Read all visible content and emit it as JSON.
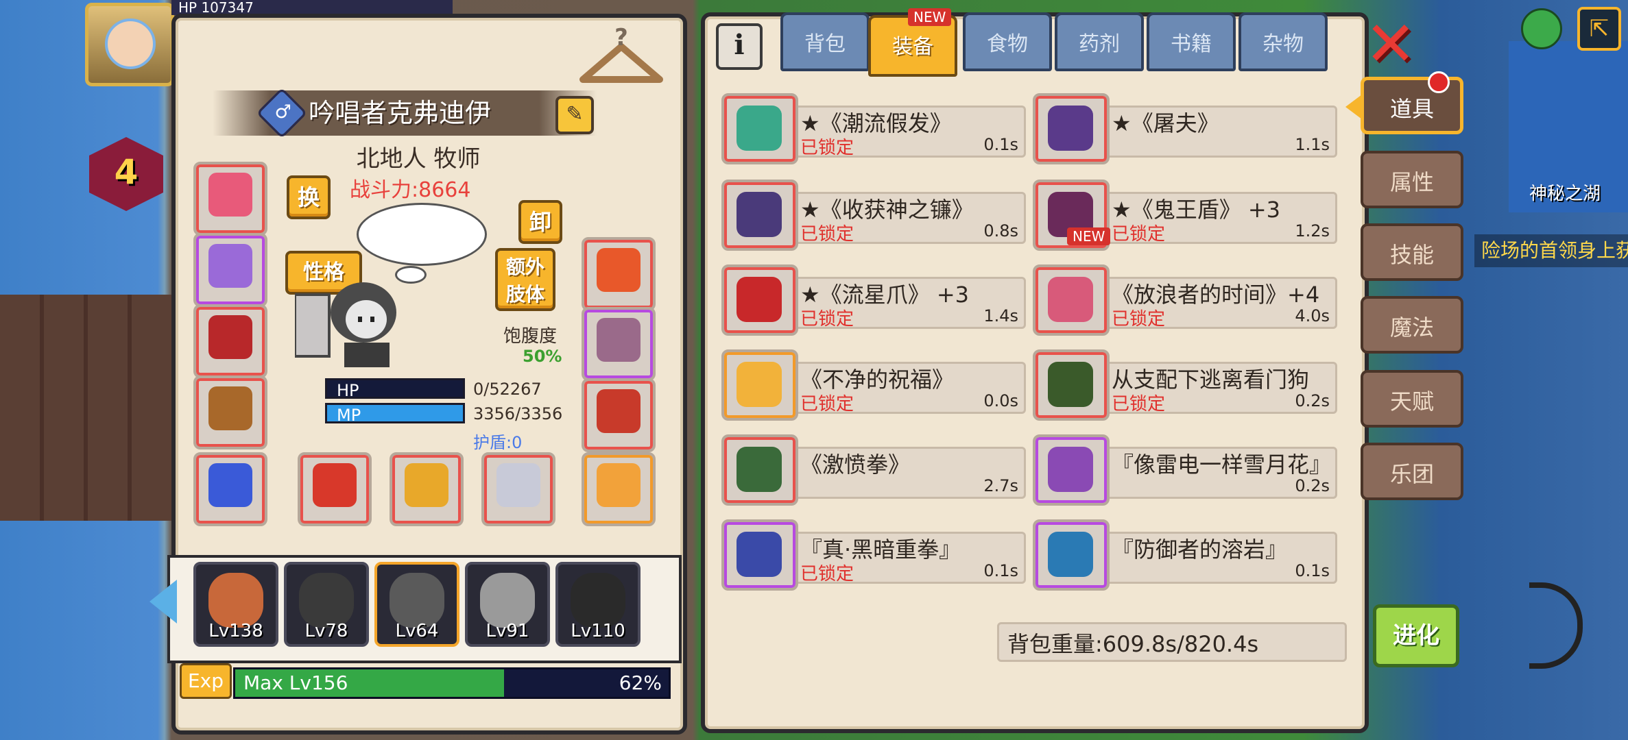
{
  "scene": {
    "lake_label": "神秘之湖",
    "quest_text": "险场的首领身上获",
    "hp_strip": "HP  107347",
    "level_badge": "4"
  },
  "character": {
    "name": "吟唱者克弗迪伊",
    "class": "北地人 牧师",
    "combat_power": "战斗力:8664",
    "swap_label": "换",
    "unequip_label": "卸",
    "personality_label": "性格",
    "extra_limb_label": "额外肢体",
    "satiety_label": "饱腹度",
    "satiety_value": "50%",
    "hp_label": "HP",
    "hp_value": "0/52267",
    "mp_label": "MP",
    "mp_value": "3356/3356",
    "shield": "护盾:0",
    "mp_fill": 1.0,
    "hp_fill": 0.0
  },
  "party": [
    {
      "level": "Lv138",
      "selected": false
    },
    {
      "level": "Lv78",
      "selected": false
    },
    {
      "level": "Lv64",
      "selected": true
    },
    {
      "level": "Lv91",
      "selected": false
    },
    {
      "level": "Lv110",
      "selected": false
    }
  ],
  "exp": {
    "icon_label": "Exp",
    "text": "Max Lv156",
    "percent": "62%",
    "fill": 0.62
  },
  "tabs": [
    {
      "label": "背包",
      "active": false
    },
    {
      "label": "装备",
      "active": true,
      "badge": "NEW"
    },
    {
      "label": "食物",
      "active": false
    },
    {
      "label": "药剂",
      "active": false
    },
    {
      "label": "书籍",
      "active": false
    },
    {
      "label": "杂物",
      "active": false
    }
  ],
  "items": [
    {
      "name": "★《潮流假发》",
      "locked": "已锁定",
      "weight": "0.1s",
      "rarity": "r",
      "color": "#3aa88a"
    },
    {
      "name": "★《屠夫》",
      "locked": "",
      "weight": "1.1s",
      "rarity": "r",
      "color": "#5a3a8a"
    },
    {
      "name": "★《收获神之镰》",
      "locked": "已锁定",
      "weight": "0.8s",
      "rarity": "r",
      "color": "#4a3a7a"
    },
    {
      "name": "★《鬼王盾》 +3",
      "locked": "已锁定",
      "weight": "1.2s",
      "rarity": "r",
      "color": "#6a2a5a",
      "badge": "NEW"
    },
    {
      "name": "★《流星爪》 +3",
      "locked": "已锁定",
      "weight": "1.4s",
      "rarity": "r",
      "color": "#c8282a"
    },
    {
      "name": "《放浪者的时间》+4",
      "locked": "已锁定",
      "weight": "4.0s",
      "rarity": "r",
      "color": "#d85a7a"
    },
    {
      "name": "《不净的祝福》",
      "locked": "已锁定",
      "weight": "0.0s",
      "rarity": "o",
      "color": "#f2b23a"
    },
    {
      "name": "从支配下逃离看门狗",
      "locked": "已锁定",
      "weight": "0.2s",
      "rarity": "r",
      "color": "#3a5a2a"
    },
    {
      "name": "《激愤拳》",
      "locked": "",
      "weight": "2.7s",
      "rarity": "r",
      "color": "#3a6a3a"
    },
    {
      "name": "『像雷电一样雪月花』",
      "locked": "",
      "weight": "0.2s",
      "rarity": "p",
      "color": "#8a4ab4"
    },
    {
      "name": "『真·黑暗重拳』",
      "locked": "已锁定",
      "weight": "0.1s",
      "rarity": "p",
      "color": "#3a4aa8"
    },
    {
      "name": "『防御者的溶岩』",
      "locked": "",
      "weight": "0.1s",
      "rarity": "p",
      "color": "#2a7ab4"
    }
  ],
  "bag_weight": "背包重量:609.8s/820.4s",
  "side_tabs": [
    {
      "label": "道具",
      "active": true
    },
    {
      "label": "属性",
      "active": false
    },
    {
      "label": "技能",
      "active": false
    },
    {
      "label": "魔法",
      "active": false
    },
    {
      "label": "天赋",
      "active": false
    },
    {
      "label": "乐团",
      "active": false
    }
  ],
  "evolve_label": "进化",
  "info_label": "i",
  "close_label": "✕",
  "equipment_colors": [
    "#e85a7a",
    "#9a6ad8",
    "#b8282a",
    "#a8682a",
    "#3a5ad8",
    "#d8382a",
    "#e8a82a",
    "#c8cad8",
    "#e8582a",
    "#9a6a8a",
    "#c83a2a",
    "#f2a23a"
  ]
}
